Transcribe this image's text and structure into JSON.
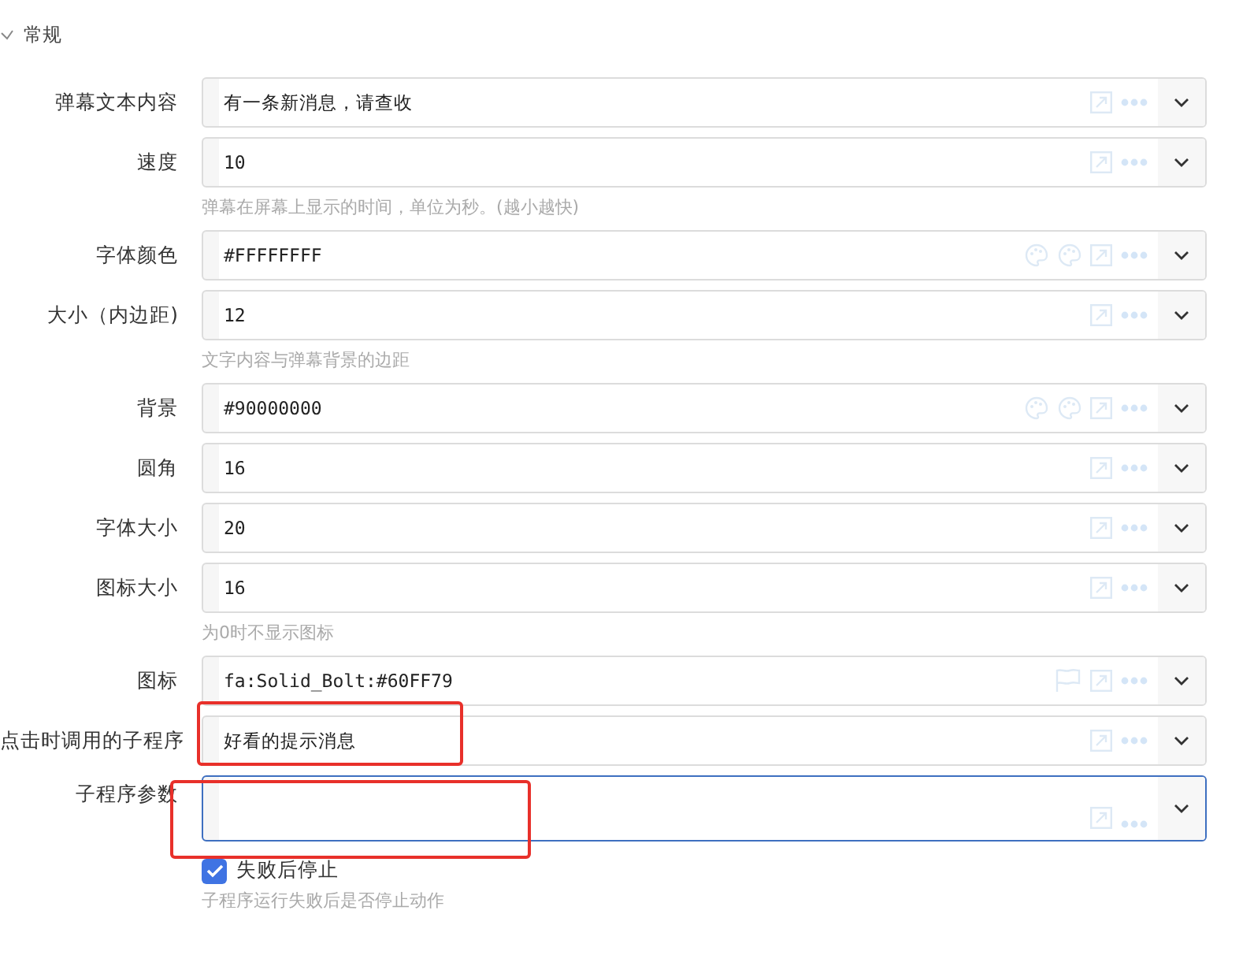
{
  "section": {
    "title": "常规",
    "expanded": true
  },
  "fields": [
    {
      "label": "弹幕文本内容",
      "kind": "text",
      "value": "有一条新消息，请查收",
      "focused": false,
      "highlighted": false
    },
    {
      "label": "速度",
      "kind": "text",
      "value": "10",
      "hint": "弹幕在屏幕上显示的时间，单位为秒。(越小越快)",
      "focused": false,
      "highlighted": false
    },
    {
      "label": "字体颜色",
      "kind": "color",
      "value": "#FFFFFFFF",
      "focused": false,
      "highlighted": false
    },
    {
      "label": "大小（内边距)",
      "kind": "text",
      "value": "12",
      "hint": "文字内容与弹幕背景的边距",
      "focused": false,
      "highlighted": false
    },
    {
      "label": "背景",
      "kind": "color",
      "value": "#90000000",
      "focused": false,
      "highlighted": false
    },
    {
      "label": "圆角",
      "kind": "text",
      "value": "16",
      "focused": false,
      "highlighted": false
    },
    {
      "label": "字体大小",
      "kind": "text",
      "value": "20",
      "focused": false,
      "highlighted": false
    },
    {
      "label": "图标大小",
      "kind": "text",
      "value": "16",
      "hint": "为0时不显示图标",
      "focused": false,
      "highlighted": false
    },
    {
      "label": "图标",
      "kind": "icon",
      "value": "fa:Solid_Bolt:#60FF79",
      "focused": false,
      "highlighted": false
    },
    {
      "label": "点击时调用的子程序",
      "kind": "text",
      "value": "好看的提示消息",
      "focused": false,
      "highlighted": true
    },
    {
      "label": "子程序参数",
      "kind": "multiline",
      "focused": true,
      "highlighted": true
    }
  ],
  "checkbox": {
    "label": "失败后停止",
    "checked": true,
    "hint": "子程序运行失败后是否停止动作"
  }
}
